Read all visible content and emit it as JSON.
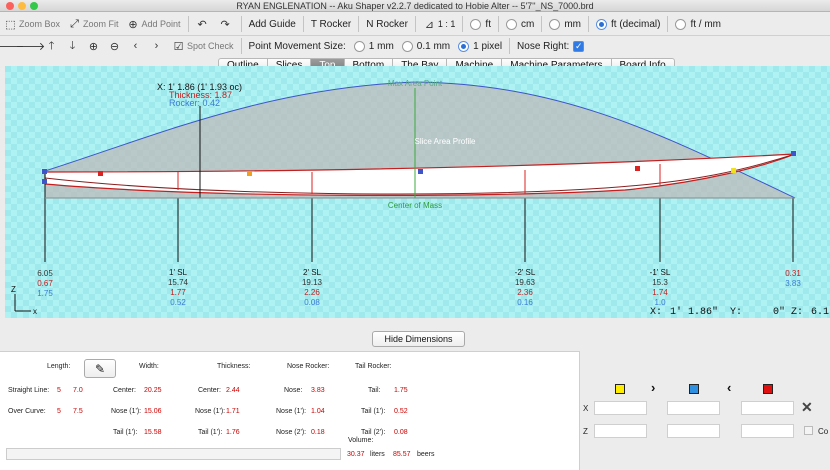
{
  "window": {
    "title": "RYAN ENGLENATION -- Aku Shaper v2.2.7 dedicated to Hobie Alter  --  5'7''_NS_7000.brd"
  },
  "toolbar1": {
    "zoom_box": "Zoom Box",
    "zoom_fit": "Zoom Fit",
    "add_point": "Add Point",
    "add_guide": "Add Guide",
    "t_rocker": "T Rocker",
    "n_rocker": "N Rocker",
    "scale": "1 : 1",
    "units": [
      "ft",
      "cm",
      "mm",
      "ft (decimal)",
      "ft / mm"
    ],
    "units_selected": "ft (decimal)"
  },
  "toolbar2": {
    "spot_check": "Spot Check",
    "pm_size_label": "Point Movement Size:",
    "pm_options": [
      "1 mm",
      "0.1 mm",
      "1 pixel"
    ],
    "pm_selected": "1 pixel",
    "nose_right_label": "Nose Right:",
    "nose_right_checked": true
  },
  "tabs": [
    "Outline",
    "Slices",
    "Top",
    "Bottom",
    "The Bay",
    "Machine",
    "Machine Parameters",
    "Board Info"
  ],
  "active_tab": "Top",
  "canvas": {
    "cursor_info": {
      "x": "X: 1' 1.86 (1' 1.93 oc)",
      "thickness": "Thickness: 1.87",
      "rocker": "Rocker: 0.42"
    },
    "max_area_point": "Max Area Point",
    "slice_area_profile": "Slice Area Profile",
    "center_of_mass": "Center of Mass",
    "stations": [
      {
        "label": "",
        "v1": "6.05",
        "v2": "0.67",
        "v3": "1.75"
      },
      {
        "label": "1' SL",
        "v1": "15.74",
        "v2": "1.77",
        "v3": "0.52"
      },
      {
        "label": "2' SL",
        "v1": "19.13",
        "v2": "2.26",
        "v3": "0.08"
      },
      {
        "label": "-2' SL",
        "v1": "19.63",
        "v2": "2.36",
        "v3": "0.16"
      },
      {
        "label": "-1' SL",
        "v1": "15.3",
        "v2": "1.74",
        "v3": "1.0"
      },
      {
        "label": "",
        "v1": "0.31",
        "v2": "3.83",
        "v3": ""
      }
    ],
    "axis_z": "Z",
    "axis_x": "x",
    "coords": {
      "x_label": "X:",
      "x_val": "1' 1.86\"",
      "y_label": "Y:",
      "y_val": "0\"",
      "z_label": "Z:",
      "z_val": "6.1"
    },
    "colors": {
      "bg": "#aef2f4",
      "outline": "#3355cc",
      "rocker": "#cc2222",
      "area": "#b8b8b8"
    }
  },
  "hide_dimensions": "Hide Dimensions",
  "dimensions": {
    "length_label": "Length:",
    "width_label": "Width:",
    "thickness_label": "Thickness:",
    "nose_rocker_label": "Nose Rocker:",
    "tail_rocker_label": "Tail Rocker:",
    "straight_line_label": "Straight Line:",
    "straight_line_ft": "5",
    "straight_line_in": "7.0",
    "over_curve_label": "Over Curve:",
    "over_curve_ft": "5",
    "over_curve_in": "7.5",
    "width_center_label": "Center:",
    "width_center": "20.25",
    "width_nose_label": "Nose (1'):",
    "width_nose": "15.06",
    "width_tail_label": "Tail (1'):",
    "width_tail": "15.58",
    "thick_center_label": "Center:",
    "thick_center": "2.44",
    "thick_nose_label": "Nose (1'):",
    "thick_nose": "1.71",
    "thick_tail_label": "Tail (1'):",
    "thick_tail": "1.76",
    "nose_label": "Nose:",
    "nose": "3.83",
    "nose1_label": "Nose (1'):",
    "nose1": "1.04",
    "nose2_label": "Nose (2'):",
    "nose2": "0.18",
    "tail_label": "Tail:",
    "tail": "1.75",
    "tail1_label": "Tail (1'):",
    "tail1": "0.52",
    "tail2_label": "Tail (2'):",
    "tail2": "0.08",
    "volume_label": "Volume:",
    "liters": "30.37",
    "liters_label": "liters",
    "beers": "85.57",
    "beers_label": "beers"
  },
  "right_panel": {
    "x_label": "X",
    "z_label": "Z",
    "co_label": "Co",
    "colors": [
      "#ffee00",
      "#2f8fe0",
      "#e01010"
    ]
  }
}
